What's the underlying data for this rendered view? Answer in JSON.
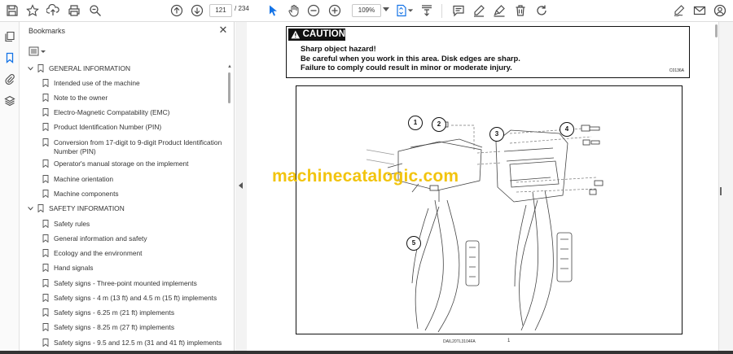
{
  "toolbar": {
    "page_current": "121",
    "page_separator_total": "/ 234",
    "zoom": "109%"
  },
  "bookmarks": {
    "title": "Bookmarks",
    "close_glyph": "✕",
    "items": [
      {
        "label": "GENERAL INFORMATION",
        "level": 0,
        "expanded": true
      },
      {
        "label": "Intended use of the machine",
        "level": 1
      },
      {
        "label": "Note to the owner",
        "level": 1
      },
      {
        "label": "Electro-Magnetic Compatability (EMC)",
        "level": 1
      },
      {
        "label": "Product Identification Number (PIN)",
        "level": 1
      },
      {
        "label": "Conversion from 17-digit to 9-digit Product Identification Number (PIN)",
        "level": 1
      },
      {
        "label": "Operator's manual storage on the implement",
        "level": 1
      },
      {
        "label": "Machine orientation",
        "level": 1
      },
      {
        "label": "Machine components",
        "level": 1
      },
      {
        "label": "SAFETY INFORMATION",
        "level": 0,
        "expanded": true
      },
      {
        "label": "Safety rules",
        "level": 1
      },
      {
        "label": "General information and safety",
        "level": 1
      },
      {
        "label": "Ecology and the environment",
        "level": 1
      },
      {
        "label": "Hand signals",
        "level": 1
      },
      {
        "label": "Safety signs - Three-point mounted implements",
        "level": 1
      },
      {
        "label": "Safety signs - 4 m (13 ft) and 4.5 m (15 ft) implements",
        "level": 1
      },
      {
        "label": "Safety signs - 6.25 m (21 ft) implements",
        "level": 1
      },
      {
        "label": "Safety signs - 8.25 m (27 ft) implements",
        "level": 1
      },
      {
        "label": "Safety signs - 9.5 and 12.5 m (31 and 41 ft) implements",
        "level": 1
      }
    ]
  },
  "document": {
    "caution_title": "CAUTION",
    "caution_lines": [
      "Sharp object hazard!",
      "Be careful when you work in this area. Disk edges are sharp.",
      "Failure to comply could result in minor or moderate injury."
    ],
    "caution_code": "C0136A",
    "figure_caption": "DAIL20TL3104FA",
    "figure_number": "1",
    "callouts": [
      "1",
      "2",
      "3",
      "4",
      "5"
    ],
    "watermark": "machinecatalogic.com"
  },
  "colors": {
    "watermark": "#f2c40f",
    "toolbar_icon": "#4a4a4a",
    "selected_tool": "#1473e6"
  },
  "icons": [
    "save-icon",
    "bookmark-star-icon",
    "upload-icon",
    "print-icon",
    "zoom-search-icon",
    "prev-page-icon",
    "next-page-icon",
    "select-cursor-icon",
    "hand-icon",
    "zoom-out-icon",
    "zoom-in-icon",
    "fit-page-icon",
    "scroll-mode-icon",
    "comment-icon",
    "pen-icon",
    "highlight-icon",
    "delete-icon",
    "rotate-icon",
    "sign-icon",
    "mail-icon",
    "account-icon"
  ]
}
